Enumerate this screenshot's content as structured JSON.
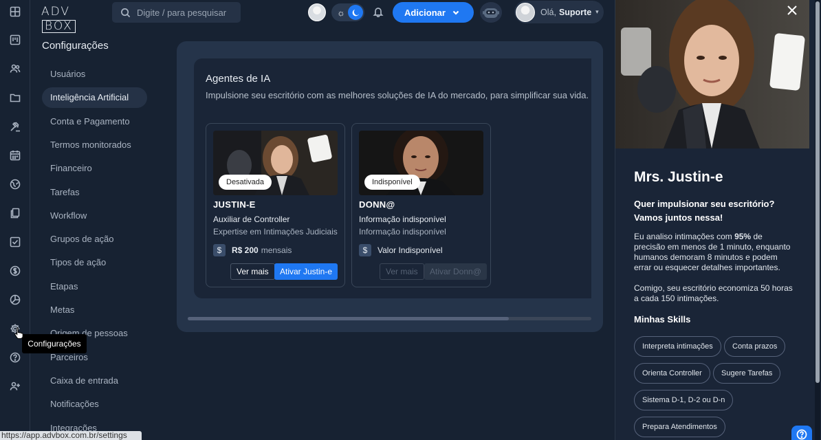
{
  "rail": {
    "items": [
      "dashboard-icon",
      "kanban-icon",
      "users-icon",
      "folder-icon",
      "gavel-icon",
      "calendar-icon",
      "globe-icon",
      "documents-icon",
      "tasks-check-icon",
      "dollar-icon",
      "chart-pie-icon",
      "settings-gear-icon",
      "help-icon",
      "add-user-icon"
    ]
  },
  "header": {
    "logo_adv": "ADV",
    "logo_box": "BOX",
    "search_placeholder": "Digite / para pesquisar",
    "add_label": "Adicionar",
    "greeting": "Olá,",
    "user_name": "Suporte"
  },
  "settings": {
    "title": "Configurações",
    "items": [
      {
        "label": "Usuários",
        "active": false
      },
      {
        "label": "Inteligência Artificial",
        "active": true
      },
      {
        "label": "Conta e Pagamento",
        "active": false
      },
      {
        "label": "Termos monitorados",
        "active": false
      },
      {
        "label": "Financeiro",
        "active": false
      },
      {
        "label": "Tarefas",
        "active": false
      },
      {
        "label": "Workflow",
        "active": false
      },
      {
        "label": "Grupos de ação",
        "active": false
      },
      {
        "label": "Tipos de ação",
        "active": false
      },
      {
        "label": "Etapas",
        "active": false
      },
      {
        "label": "Metas",
        "active": false
      },
      {
        "label": "Origem de pessoas",
        "active": false
      },
      {
        "label": "Parceiros",
        "active": false
      },
      {
        "label": "Caixa de entrada",
        "active": false
      },
      {
        "label": "Notificações",
        "active": false
      },
      {
        "label": "Integrações",
        "active": false
      }
    ]
  },
  "tooltip": "Configurações",
  "agents_section": {
    "title": "Agentes de IA",
    "subtitle": "Impulsione seu escritório com as melhores soluções de IA do mercado, para simplificar sua vida.",
    "agents": [
      {
        "badge": "Desativada",
        "name": "JUSTIN-E",
        "role": "Auxiliar de Controller",
        "desc": "Expertise em Intimações Judiciais",
        "price": "R$ 200",
        "price_suffix": "mensais",
        "more": "Ver mais",
        "activate": "Ativar Justin-e",
        "enabled": true
      },
      {
        "badge": "Indisponível",
        "name": "DONN@",
        "role": "Informação indisponível",
        "desc": "Informação indisponível",
        "price": "Valor Indisponível",
        "price_suffix": "",
        "more": "Ver mais",
        "activate": "Ativar Donn@",
        "enabled": false
      }
    ]
  },
  "drawer": {
    "title": "Mrs. Justin-e",
    "lead": "Quer impulsionar seu escritório? Vamos juntos nessa!",
    "body_pre": "Eu analiso intimações com ",
    "body_pct": "95%",
    "body_post": " de precisão em menos de 1 minuto, enquanto humanos demoram 8 minutos e podem errar ou esquecer detalhes importantes.",
    "body2": "Comigo, seu escritório economiza 50 horas a cada 150 intimações.",
    "skills_title": "Minhas Skills",
    "skills": [
      "Interpreta intimações",
      "Conta prazos",
      "Orienta Controller",
      "Sugere Tarefas",
      "Sistema D-1, D-2 ou D-n",
      "Prepara Atendimentos"
    ]
  },
  "statusbar": "https://app.advbox.com.br/settings",
  "colors": {
    "accent": "#1f78f2",
    "background": "#172232",
    "card": "#25344a"
  }
}
